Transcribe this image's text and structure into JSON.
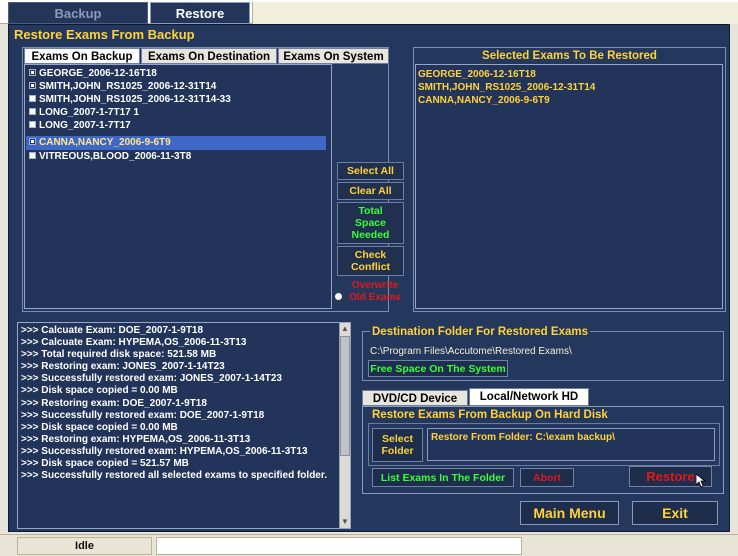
{
  "top_tabs": [
    {
      "label": "Backup"
    },
    {
      "label": "Restore"
    }
  ],
  "main_title": "Restore Exams From Backup",
  "exam_tabs": [
    "Exams On Backup",
    "Exams On Destination",
    "Exams On System"
  ],
  "exam_list": [
    {
      "label": "GEORGE_2006-12-16T18",
      "checked": true
    },
    {
      "label": "SMITH,JOHN_RS1025_2006-12-31T14",
      "checked": true
    },
    {
      "label": "SMITH,JOHN_RS1025_2006-12-31T14-33",
      "checked": false
    },
    {
      "label": "LONG_2007-1-7T17 1",
      "checked": false
    },
    {
      "label": "LONG_2007-1-7T17",
      "checked": false
    },
    {
      "label": "CANNA,NANCY_2006-9-6T9",
      "checked": true,
      "selected": true
    },
    {
      "label": "VITREOUS,BLOOD_2006-11-3T8",
      "checked": false
    }
  ],
  "mid_buttons": {
    "select_all": "Select All",
    "clear_all": "Clear All",
    "total_space": "Total Space Needed",
    "check_conflict": "Check Conflict",
    "overwrite": "Overwrite Old Exams"
  },
  "selected_title": "Selected Exams To Be Restored",
  "selected_exams": [
    "GEORGE_2006-12-16T18",
    "SMITH,JOHN_RS1025_2006-12-31T14",
    "CANNA,NANCY_2006-9-6T9"
  ],
  "log": [
    ">>> Calcuate Exam: DOE_2007-1-9T18",
    ">>> Calcuate Exam: HYPEMA,OS_2006-11-3T13",
    ">>> Total required disk space: 521.58 MB",
    ">>> Restoring exam: JONES_2007-1-14T23",
    ">>> Successfully restored exam: JONES_2007-1-14T23",
    ">>> Disk space copied = 0.00 MB",
    ">>> Restoring exam: DOE_2007-1-9T18",
    ">>> Successfully restored exam: DOE_2007-1-9T18",
    ">>> Disk space copied = 0.00 MB",
    ">>> Restoring exam: HYPEMA,OS_2006-11-3T13",
    ">>> Successfully restored exam: HYPEMA,OS_2006-11-3T13",
    ">>> Disk space copied = 521.57 MB",
    ">>> Successfully restored all selected exams to specified folder."
  ],
  "destination": {
    "title": "Destination Folder For Restored Exams",
    "path": "C:\\Program Files\\Accutome\\Restored Exams\\",
    "free_space_button": "Free Space On The System"
  },
  "source_tabs": [
    "DVD/CD Device",
    "Local/Network HD"
  ],
  "hard_disk": {
    "title": "Restore Exams From Backup On Hard Disk",
    "select_folder": "Select Folder",
    "restore_from": "Restore From Folder: C:\\exam backup\\",
    "list_exams": "List Exams In The Folder",
    "abort": "Abort",
    "restore": "Restore"
  },
  "bottom_buttons": {
    "main_menu": "Main Menu",
    "exit": "Exit"
  },
  "status": {
    "text": "Idle",
    "field_value": ""
  },
  "colors": {
    "panel": "#24375c",
    "accent_yellow": "#ffd23a",
    "green_text": "#38ff38",
    "red_text": "#e01818"
  }
}
